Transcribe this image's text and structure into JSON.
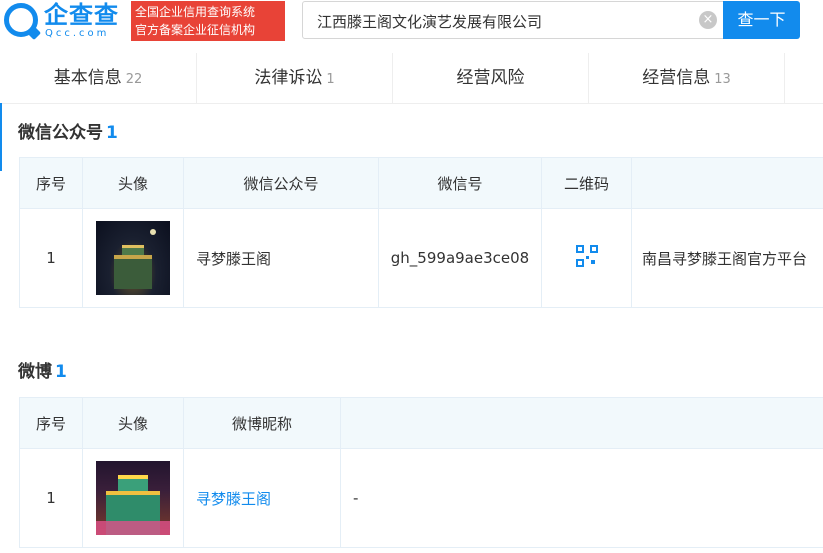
{
  "header": {
    "logo_text": "企查查",
    "logo_domain": "Qcc.com",
    "slogan_line1": "全国企业信用查询系统",
    "slogan_line2": "官方备案企业征信机构",
    "search_value": "江西滕王阁文化演艺发展有限公司",
    "clear_icon": "×",
    "search_button": "查一下"
  },
  "tabs": [
    {
      "label": "基本信息",
      "count": "22"
    },
    {
      "label": "法律诉讼",
      "count": "1"
    },
    {
      "label": "经营风险",
      "count": ""
    },
    {
      "label": "经营信息",
      "count": "13"
    }
  ],
  "wechat": {
    "title": "微信公众号",
    "count": "1",
    "headers": [
      "序号",
      "头像",
      "微信公众号",
      "微信号",
      "二维码",
      ""
    ],
    "rows": [
      {
        "index": "1",
        "name": "寻梦滕王阁",
        "wechat_id": "gh_599a9ae3ce08",
        "desc": "南昌寻梦滕王阁官方平台"
      }
    ]
  },
  "weibo": {
    "title": "微博",
    "count": "1",
    "headers": [
      "序号",
      "头像",
      "微博昵称",
      ""
    ],
    "rows": [
      {
        "index": "1",
        "nickname": "寻梦滕王阁",
        "desc": "-"
      }
    ]
  },
  "colors": {
    "accent": "#128bed",
    "slogan_bg": "#e84337",
    "table_header_bg": "#f2f9fc"
  }
}
